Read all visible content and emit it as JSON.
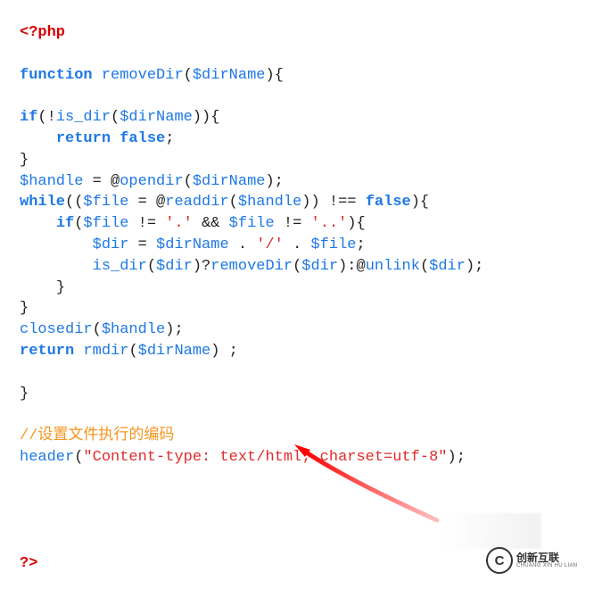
{
  "code": {
    "php_open": "<?php",
    "fn_kw": "function",
    "fn_name": "removeDir",
    "param": "$dirName",
    "if_kw": "if",
    "is_dir": "is_dir",
    "return_kw": "return",
    "false_kw": "false",
    "handle": "$handle",
    "opendir": "opendir",
    "while_kw": "while",
    "file": "$file",
    "readdir": "readdir",
    "str_dot": "'.'",
    "str_dotdot": "'..'",
    "amp": "&&",
    "dir": "$dir",
    "str_slash": "'/'",
    "unlink": "unlink",
    "closedir": "closedir",
    "rmdir": "rmdir",
    "comment": "//设置文件执行的编码",
    "header": "header",
    "header_str": "\"Content-type: text/html; charset=utf-8\"",
    "php_close": "?>"
  },
  "logo": {
    "cn": "创新互联",
    "en": "CHUANG XIN HU LIAN",
    "mark": "C"
  }
}
